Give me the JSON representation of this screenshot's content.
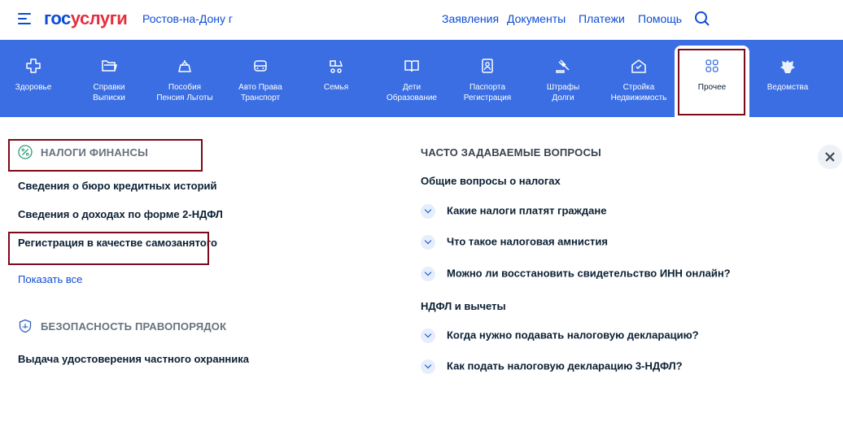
{
  "header": {
    "logo_part1": "гос",
    "logo_part2": "услуги",
    "city": "Ростов-на-Дону г",
    "nav": [
      "Заявления",
      "Документы",
      "Платежи",
      "Помощь"
    ]
  },
  "categories": [
    {
      "l1": "Здоровье",
      "l2": "",
      "icon": "plus-icon"
    },
    {
      "l1": "Справки",
      "l2": "Выписки",
      "icon": "folder-icon"
    },
    {
      "l1": "Пособия",
      "l2": "Пенсия Льготы",
      "icon": "purse-icon"
    },
    {
      "l1": "Авто Права",
      "l2": "Транспорт",
      "icon": "car-icon"
    },
    {
      "l1": "Семья",
      "l2": "",
      "icon": "stroller-icon"
    },
    {
      "l1": "Дети",
      "l2": "Образование",
      "icon": "book-icon"
    },
    {
      "l1": "Паспорта",
      "l2": "Регистрация",
      "icon": "passport-icon"
    },
    {
      "l1": "Штрафы",
      "l2": "Долги",
      "icon": "gavel-icon"
    },
    {
      "l1": "Стройка",
      "l2": "Недвижимость",
      "icon": "house-icon"
    },
    {
      "l1": "Прочее",
      "l2": "",
      "icon": "grid-icon"
    },
    {
      "l1": "Ведомства",
      "l2": "",
      "icon": "emblem-icon"
    }
  ],
  "left": {
    "section1": {
      "title": "Налоги финансы",
      "items": [
        "Сведения о бюро кредитных историй",
        "Сведения о доходах по форме 2-НДФЛ",
        "Регистрация в качестве самозанятого"
      ],
      "show_all": "Показать все"
    },
    "section2": {
      "title": "Безопасность правопорядок",
      "items": [
        "Выдача удостоверения частного охранника"
      ]
    }
  },
  "faq": {
    "title": "Часто задаваемые вопросы",
    "groups": [
      {
        "title": "Общие вопросы о налогах",
        "items": [
          "Какие налоги платят граждане",
          "Что такое налоговая амнистия",
          "Можно ли восстановить свидетельство ИНН онлайн?"
        ]
      },
      {
        "title": "НДФЛ и вычеты",
        "items": [
          "Когда нужно подавать налоговую декларацию?",
          "Как подать налоговую декларацию 3-НДФЛ?"
        ]
      }
    ]
  }
}
